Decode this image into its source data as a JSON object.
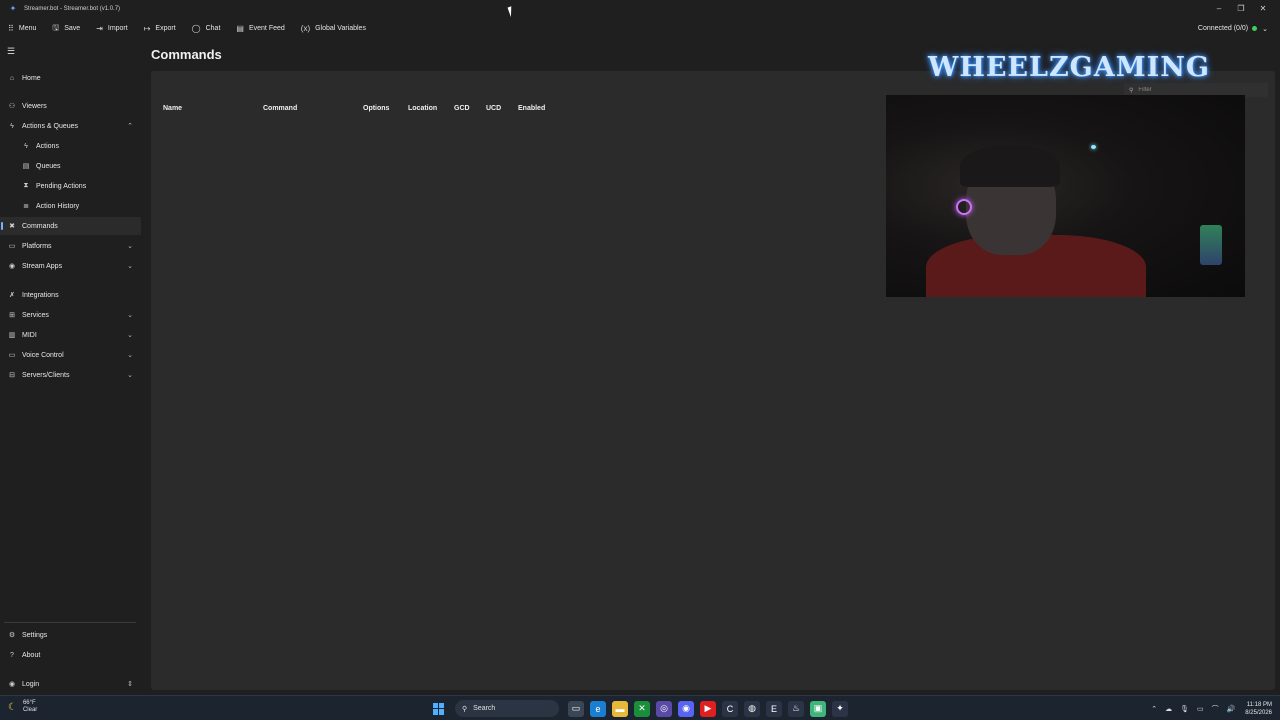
{
  "window": {
    "title": "Streamer.bot - Streamer.bot (v1.0.7)",
    "controls": [
      "–",
      "❐",
      "✕"
    ]
  },
  "menubar": {
    "items": [
      {
        "label": "Menu",
        "icon": "grid-icon"
      },
      {
        "label": "Save",
        "icon": "save-icon"
      },
      {
        "label": "Import",
        "icon": "import-icon"
      },
      {
        "label": "Export",
        "icon": "export-icon"
      },
      {
        "label": "Chat",
        "icon": "chat-icon"
      },
      {
        "label": "Event Feed",
        "icon": "feed-icon"
      },
      {
        "label": "Global Variables",
        "icon": "variables-icon"
      }
    ],
    "connection": "Connected (0/0)",
    "connection_color": "#3ecf5b"
  },
  "sidebar": {
    "items": [
      {
        "label": "Home",
        "icon": "home-icon"
      },
      {
        "label": "Viewers",
        "icon": "viewers-icon"
      },
      {
        "label": "Actions & Queues",
        "icon": "actions-icon",
        "expanded": true
      },
      {
        "label": "Actions",
        "icon": "bolt-icon"
      },
      {
        "label": "Queues",
        "icon": "queue-icon"
      },
      {
        "label": "Pending Actions",
        "icon": "pending-icon"
      },
      {
        "label": "Action History",
        "icon": "history-icon"
      },
      {
        "label": "Commands",
        "icon": "commands-icon",
        "active": true
      },
      {
        "label": "Platforms",
        "icon": "platforms-icon"
      },
      {
        "label": "Stream Apps",
        "icon": "stream-apps-icon"
      },
      {
        "label": "Integrations",
        "icon": "integrations-icon"
      },
      {
        "label": "Services",
        "icon": "services-icon"
      },
      {
        "label": "MIDI",
        "icon": "midi-icon"
      },
      {
        "label": "Voice Control",
        "icon": "voice-icon"
      },
      {
        "label": "Servers/Clients",
        "icon": "servers-icon"
      },
      {
        "label": "Settings",
        "icon": "gear-icon"
      },
      {
        "label": "About",
        "icon": "question-icon"
      },
      {
        "label": "Login",
        "icon": "user-icon"
      }
    ]
  },
  "main": {
    "title": "Commands",
    "filter_placeholder": "Filter",
    "columns": [
      "Name",
      "Command",
      "Options",
      "Location",
      "GCD",
      "UCD",
      "Enabled"
    ]
  },
  "overlay": {
    "brand": "WHEELZGAMING"
  },
  "taskbar": {
    "weather_temp": "66°F",
    "weather_desc": "Clear",
    "search_label": "Search",
    "time": "11:18 PM",
    "date": "8/25/2026"
  }
}
